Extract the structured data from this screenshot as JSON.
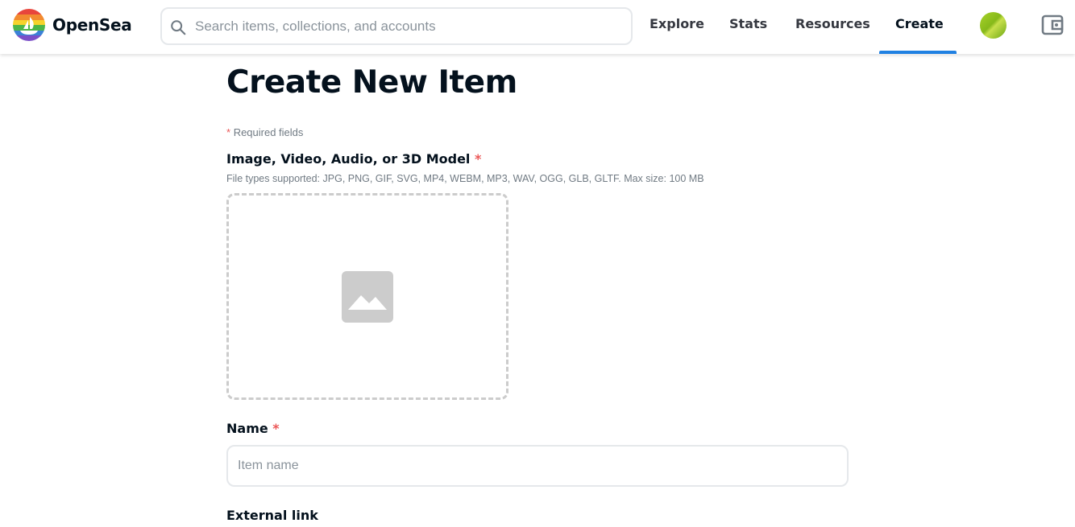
{
  "header": {
    "brand": "OpenSea",
    "search": {
      "placeholder": "Search items, collections, and accounts",
      "value": ""
    },
    "nav": [
      {
        "label": "Explore"
      },
      {
        "label": "Stats"
      },
      {
        "label": "Resources"
      },
      {
        "label": "Create",
        "active": true
      }
    ],
    "icons": {
      "search": "search-icon",
      "profile": "avatar",
      "wallet": "wallet-icon"
    },
    "accent_color": "#2081e2"
  },
  "page": {
    "title": "Create New Item",
    "required_note_star": "*",
    "required_note": "Required fields",
    "media": {
      "label": "Image, Video, Audio, or 3D Model",
      "required_star": "*",
      "hint": "File types supported: JPG, PNG, GIF, SVG, MP4, WEBM, MP3, WAV, OGG, GLB, GLTF. Max size: 100 MB",
      "icon": "image-icon"
    },
    "name_field": {
      "label": "Name",
      "required_star": "*",
      "placeholder": "Item name",
      "value": ""
    },
    "external_link": {
      "label": "External link"
    }
  }
}
